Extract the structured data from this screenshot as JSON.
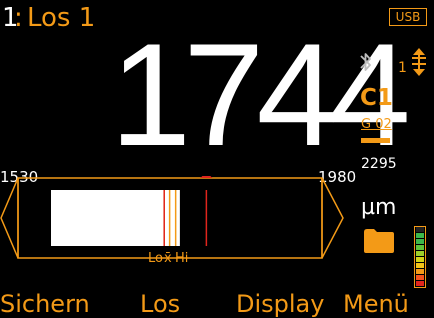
{
  "header": {
    "batch_number": "1",
    "batch_separator": ":",
    "batch_name": "Los 1",
    "usb_badge": "USB"
  },
  "reading": {
    "value": "1744",
    "unit": "µm"
  },
  "status": {
    "bluetooth_icon": "bluetooth-icon",
    "probe_number": "1",
    "probe_icon": "probe-icon",
    "calibration": "C1",
    "group": "G 02",
    "upper_limit": "2295",
    "folder_icon": "folder-icon",
    "battery_level_fraction": 0.9
  },
  "bargraph": {
    "scale_min": "1530",
    "scale_max": "1980",
    "lo_label": "Lo",
    "x_label": "x̄",
    "hi_label": "Hi",
    "range_min_value": 1530,
    "range_max_value": 1980,
    "current_value": 1744,
    "lower_limit_value": 1718,
    "upper_limit_marker_value": 1788,
    "lo_value": 1718,
    "mean_value": 1727,
    "hi_value": 1737,
    "colors": {
      "fill": "#ffffff",
      "limit": "#e0251d",
      "stats": "#f39a17",
      "outline": "#f39a17"
    }
  },
  "softkeys": {
    "key1": "Sichern",
    "key2": "Los",
    "key3": "Display",
    "key4": "Menü"
  }
}
